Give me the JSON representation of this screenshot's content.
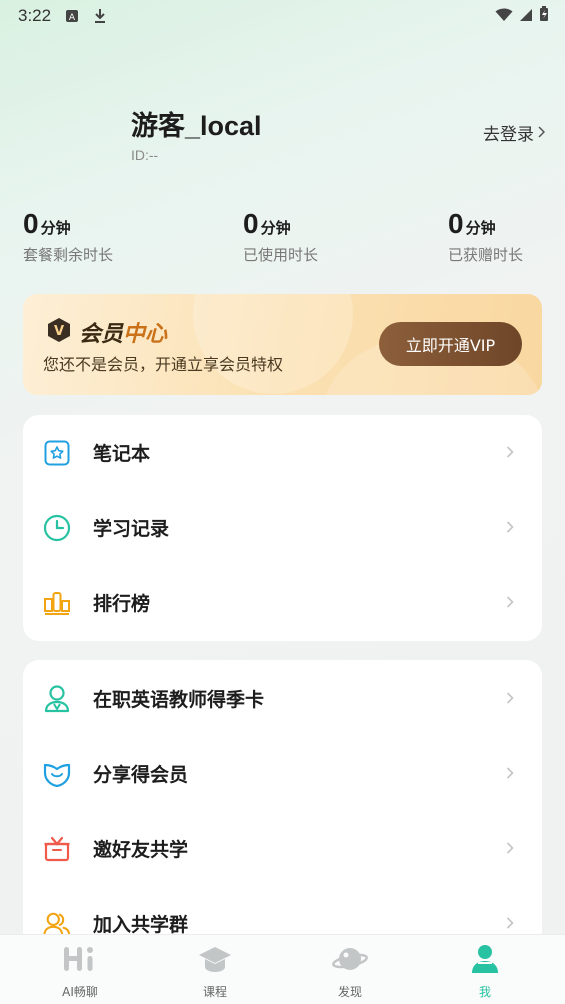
{
  "status_bar": {
    "time": "3:22"
  },
  "profile": {
    "name": "游客_local",
    "id": "ID:--",
    "login_label": "去登录"
  },
  "stats": [
    {
      "num": "0",
      "unit": "分钟",
      "label": "套餐剩余时长"
    },
    {
      "num": "0",
      "unit": "分钟",
      "label": "已使用时长"
    },
    {
      "num": "0",
      "unit": "分钟",
      "label": "已获赠时长"
    }
  ],
  "vip": {
    "title_a": "会员",
    "title_b": "中心",
    "badge": "V",
    "desc": "您还不是会员，开通立享会员特权",
    "button": "立即开通VIP"
  },
  "menu1": [
    {
      "label": "笔记本",
      "icon": "notebook-icon"
    },
    {
      "label": "学习记录",
      "icon": "clock-icon"
    },
    {
      "label": "排行榜",
      "icon": "ranking-icon"
    }
  ],
  "menu2": [
    {
      "label": "在职英语教师得季卡",
      "icon": "teacher-icon"
    },
    {
      "label": "分享得会员",
      "icon": "share-icon"
    },
    {
      "label": "邀好友共学",
      "icon": "gift-icon"
    },
    {
      "label": "加入共学群",
      "icon": "group-icon"
    }
  ],
  "tabs": [
    {
      "label": "AI畅聊",
      "icon": "ai-chat-icon"
    },
    {
      "label": "课程",
      "icon": "course-icon"
    },
    {
      "label": "发现",
      "icon": "discover-icon"
    },
    {
      "label": "我",
      "icon": "me-icon"
    }
  ],
  "colors": {
    "accent": "#27c2a2",
    "vip_button": "#7a4f2f",
    "link_blue": "#1fa0e0"
  }
}
